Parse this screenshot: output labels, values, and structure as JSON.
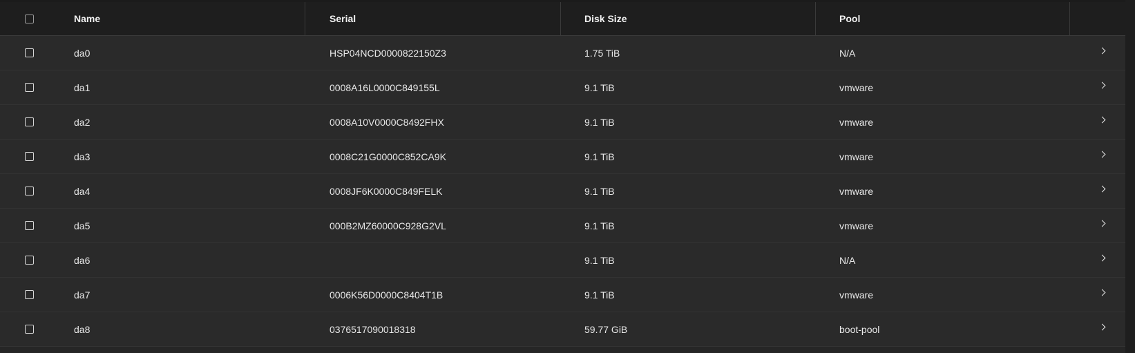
{
  "header": {
    "name": "Name",
    "serial": "Serial",
    "disk_size": "Disk Size",
    "pool": "Pool"
  },
  "rows": [
    {
      "name": "da0",
      "serial": "HSP04NCD0000822150Z3",
      "disk_size": "1.75 TiB",
      "pool": "N/A"
    },
    {
      "name": "da1",
      "serial": "0008A16L0000C849155L",
      "disk_size": "9.1 TiB",
      "pool": "vmware"
    },
    {
      "name": "da2",
      "serial": "0008A10V0000C8492FHX",
      "disk_size": "9.1 TiB",
      "pool": "vmware"
    },
    {
      "name": "da3",
      "serial": "0008C21G0000C852CA9K",
      "disk_size": "9.1 TiB",
      "pool": "vmware"
    },
    {
      "name": "da4",
      "serial": "0008JF6K0000C849FELK",
      "disk_size": "9.1 TiB",
      "pool": "vmware"
    },
    {
      "name": "da5",
      "serial": "000B2MZ60000C928G2VL",
      "disk_size": "9.1 TiB",
      "pool": "vmware"
    },
    {
      "name": "da6",
      "serial": "",
      "disk_size": "9.1 TiB",
      "pool": "N/A"
    },
    {
      "name": "da7",
      "serial": "0006K56D0000C8404T1B",
      "disk_size": "9.1 TiB",
      "pool": "vmware"
    },
    {
      "name": "da8",
      "serial": "0376517090018318",
      "disk_size": "59.77 GiB",
      "pool": "boot-pool"
    }
  ],
  "icons": {
    "select_all": "checkbox-icon",
    "row_select": "checkbox-icon",
    "expand": "chevron-right-icon"
  },
  "colors": {
    "header_bg": "#1e1e1e",
    "row_bg": "#2a2a2a",
    "text": "#e8e8e8"
  }
}
